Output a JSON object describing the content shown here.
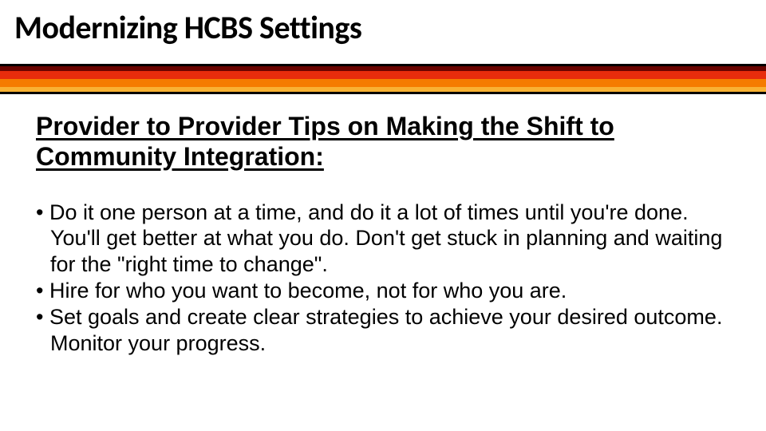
{
  "title": "Modernizing HCBS Settings",
  "subhead": "Provider to Provider Tips on Making the Shift to Community Integration:",
  "bullets": {
    "b1": "Do it one person at a time, and do it a lot of times until you're done.  You'll get better at what you do.  Don't get stuck in planning and waiting for the \"right time to change\".",
    "b2": "Hire for who you want to become, not for who you are.",
    "b3": "Set goals and create clear strategies to achieve your desired outcome.  Monitor your progress."
  },
  "bullet_glyph": "• "
}
